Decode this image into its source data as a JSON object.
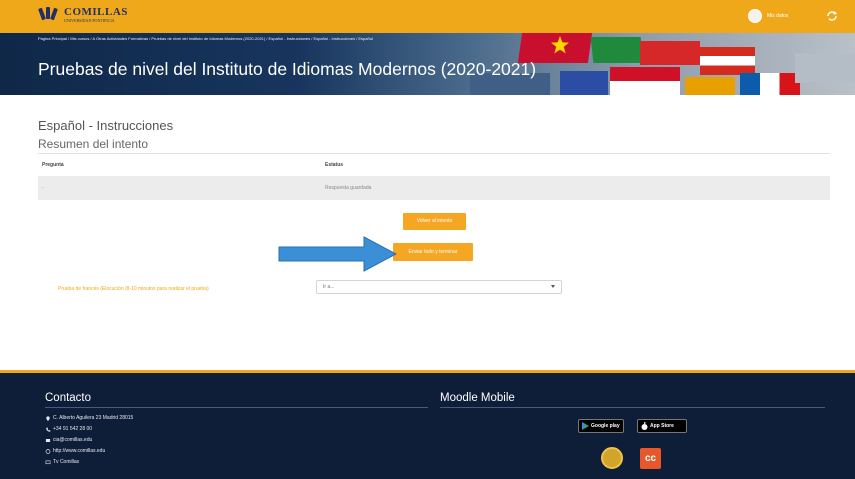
{
  "header": {
    "logo_text": "COMILLAS",
    "logo_subtext": "UNIVERSIDAD PONTIFICIA",
    "user_name": "Mis datos",
    "accent_color": "#f0a81b"
  },
  "banner": {
    "breadcrumb": "Página Principal / Mis cursos / A Otras Actividades Formativas / Pruebas de nivel del Instituto de Idiomas Modernos (2020-2021) / Español - Instrucciones / Español - Instrucciones / Español",
    "title": "Pruebas de nivel del Instituto de Idiomas Modernos (2020-2021)"
  },
  "main": {
    "section_title": "Español - Instrucciones",
    "section_subtitle": "Resumen del intento",
    "table": {
      "headers": [
        "Pregunta",
        "Estatus"
      ],
      "rows": [
        [
          "-",
          "Respuesta guardada"
        ]
      ]
    },
    "back_button": "Volver al intento",
    "submit_button": "Enviar todo y terminar",
    "nav_label": "Prueba de francés (Elocución (8-10 minutos para realizar el prueba)",
    "select_value": "Ir a..."
  },
  "footer": {
    "contact_title": "Contacto",
    "mobile_title": "Moodle Mobile",
    "contact_items": [
      {
        "icon": "location-icon",
        "text": "C. Alberto Aguilera 23 Madrid 28015"
      },
      {
        "icon": "phone-icon",
        "text": "+34 91 542 28 00"
      },
      {
        "icon": "mail-icon",
        "text": "cia@comillas.edu"
      },
      {
        "icon": "globe-icon",
        "text": "http://www.comillas.edu"
      },
      {
        "icon": "tv-icon",
        "text": "Tv Comillas"
      }
    ],
    "google_play_label": "Google play",
    "app_store_label": "App Store",
    "footer_bg": "#0e1d38"
  }
}
